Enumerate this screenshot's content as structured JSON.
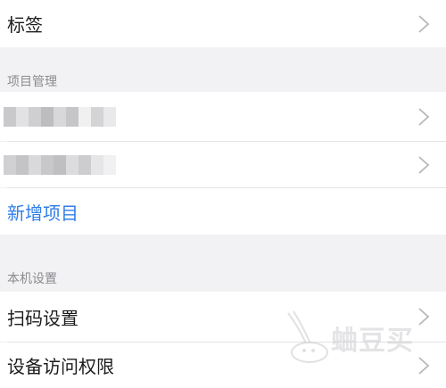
{
  "top_row": {
    "label": "标签"
  },
  "project_section": {
    "header": "项目管理",
    "new_project_label": "新增项目"
  },
  "device_section": {
    "header": "本机设置",
    "items": [
      {
        "label": "扫码设置"
      },
      {
        "label": "设备访问权限"
      }
    ]
  },
  "watermark": {
    "text": "蛐豆买"
  },
  "colors": {
    "link": "#2f7ee8",
    "background": "#f2f2f4",
    "text": "#1c1c1e",
    "section_header": "#8b8b8f"
  }
}
